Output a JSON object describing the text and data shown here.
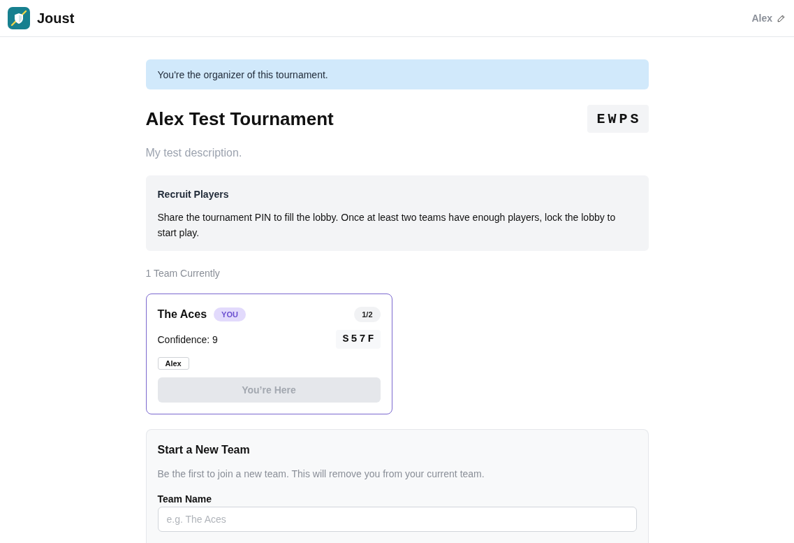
{
  "header": {
    "app_name": "Joust",
    "user_name": "Alex"
  },
  "notice": "You're the organizer of this tournament.",
  "tournament": {
    "title": "Alex Test Tournament",
    "pin": "EWPS",
    "description": "My test description."
  },
  "recruit": {
    "title": "Recruit Players",
    "text": "Share the tournament PIN to fill the lobby. Once at least two teams have enough players, lock the lobby to start play."
  },
  "team_count": "1 Team Currently",
  "teams": [
    {
      "name": "The Aces",
      "badge": "YOU",
      "current": true,
      "capacity": "1/2",
      "confidence": "Confidence: 9",
      "code": "S57F",
      "members": [
        "Alex"
      ],
      "button": {
        "label": "You’re Here",
        "disabled": true
      }
    }
  ],
  "new_team": {
    "title": "Start a New Team",
    "description": "Be the first to join a new team. This will remove you from your current team.",
    "fields": [
      {
        "label": "Team Name",
        "placeholder": "e.g. The Aces"
      }
    ]
  }
}
